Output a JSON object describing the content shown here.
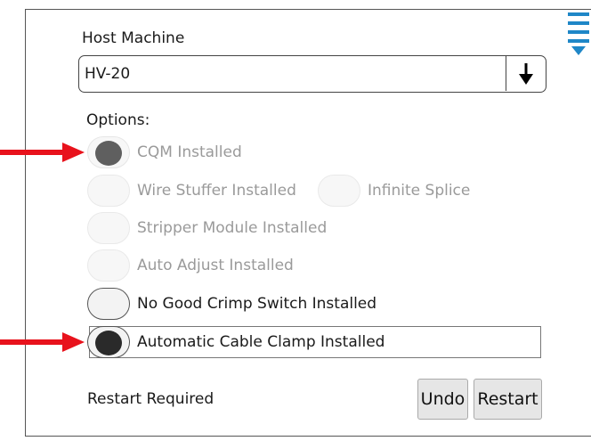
{
  "host_machine": {
    "label": "Host Machine",
    "value": "HV-20",
    "dropdown_icon": "arrow-down-icon"
  },
  "menu_icon": "menu-icon",
  "options": {
    "label": "Options:",
    "items": [
      {
        "label": "CQM Installed",
        "state": "on",
        "enabled": false
      },
      {
        "label": "Wire Stuffer Installed",
        "state": "off",
        "enabled": false
      },
      {
        "label": "Infinite Splice",
        "state": "off",
        "enabled": false
      },
      {
        "label": "Stripper Module Installed",
        "state": "off",
        "enabled": false
      },
      {
        "label": "Auto Adjust Installed",
        "state": "off",
        "enabled": false
      },
      {
        "label": "No Good Crimp Switch Installed",
        "state": "off",
        "enabled": true
      },
      {
        "label": "Automatic Cable Clamp Installed",
        "state": "on",
        "enabled": true
      }
    ]
  },
  "annotations": {
    "arrow_color": "#e8121c",
    "pointers": [
      "CQM Installed",
      "Automatic Cable Clamp Installed"
    ]
  },
  "footer": {
    "status": "Restart Required",
    "undo_label": "Undo",
    "restart_label": "Restart"
  }
}
